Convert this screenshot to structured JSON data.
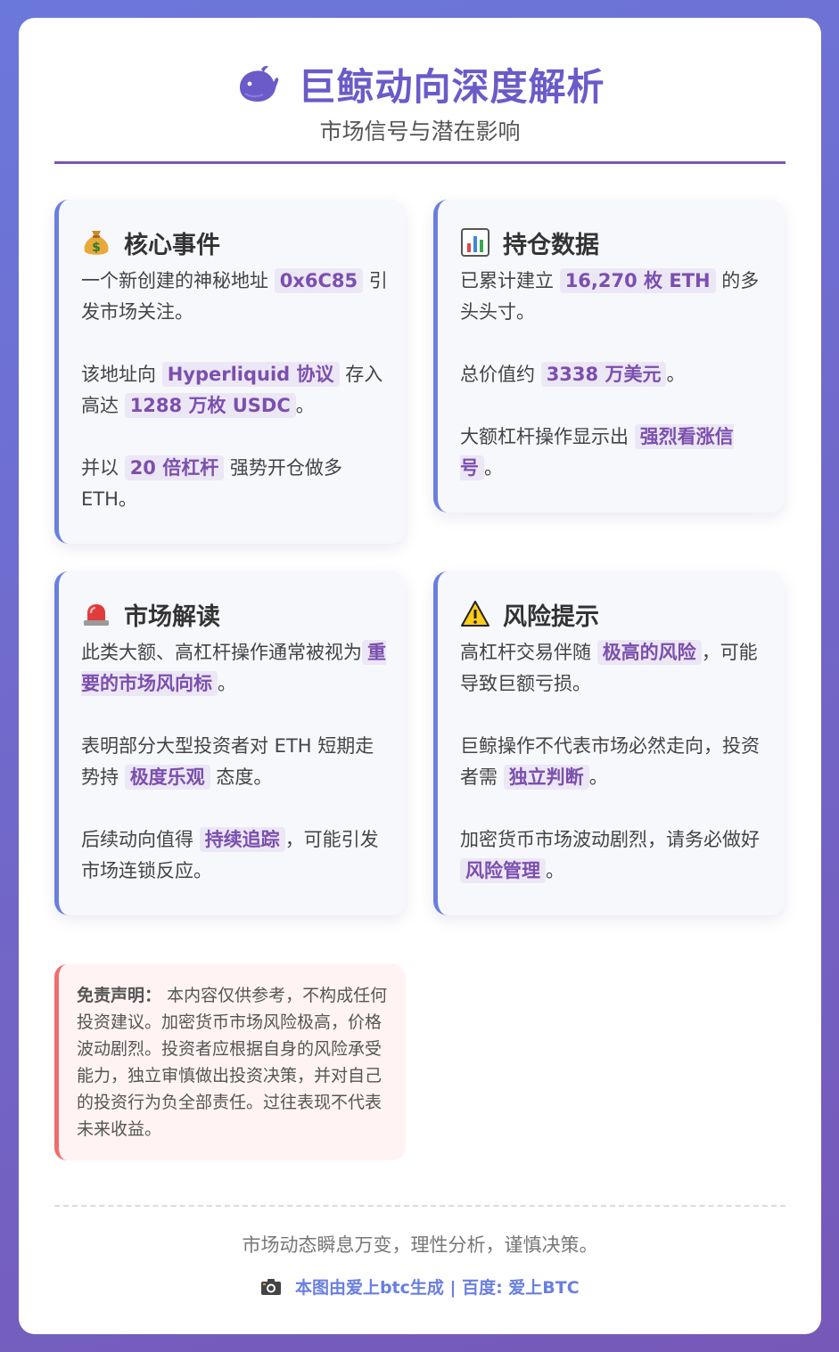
{
  "header": {
    "title": "巨鲸动向深度解析",
    "subtitle": "市场信号与潜在影响",
    "icon": "whale-icon"
  },
  "cards": {
    "core_event": {
      "icon": "money-bag-icon",
      "title": "核心事件",
      "p1_a": "一个新创建的神秘地址",
      "p1_hl": "0x6C85",
      "p1_b": "引发市场关注。",
      "p2_a": "该地址向",
      "p2_hl1": "Hyperliquid 协议",
      "p2_b": "存入高达",
      "p2_hl2": "1288 万枚 USDC",
      "p2_c": "。",
      "p3_a": "并以",
      "p3_hl": "20 倍杠杆",
      "p3_b": "强势开仓做多 ETH。"
    },
    "position": {
      "icon": "bar-chart-icon",
      "title": "持仓数据",
      "p1_a": "已累计建立",
      "p1_hl": "16,270 枚 ETH",
      "p1_b": "的多头头寸。",
      "p2_a": "总价值约",
      "p2_hl": "3338 万美元",
      "p2_b": "。",
      "p3_a": "大额杠杆操作显示出",
      "p3_hl": "强烈看涨信号",
      "p3_b": "。"
    },
    "market": {
      "icon": "siren-icon",
      "title": "市场解读",
      "p1_a": "此类大额、高杠杆操作通常被视为",
      "p1_hl": "重要的市场风向标",
      "p1_b": "。",
      "p2_a": "表明部分大型投资者对 ETH 短期走势持",
      "p2_hl": "极度乐观",
      "p2_b": "态度。",
      "p3_a": "后续动向值得",
      "p3_hl": "持续追踪",
      "p3_b": "，可能引发市场连锁反应。"
    },
    "risk": {
      "icon": "warning-icon",
      "title": "风险提示",
      "p1_a": "高杠杆交易伴随",
      "p1_hl": "极高的风险",
      "p1_b": "，可能导致巨额亏损。",
      "p2_a": "巨鲸操作不代表市场必然走向，投资者需",
      "p2_hl": "独立判断",
      "p2_b": "。",
      "p3_a": "加密货币市场波动剧烈，请务必做好",
      "p3_hl": "风险管理",
      "p3_b": "。"
    }
  },
  "disclaimer": {
    "label": "免责声明：",
    "text": "本内容仅供参考，不构成任何投资建议。加密货币市场风险极高，价格波动剧烈。投资者应根据自身的风险承受能力，独立审慎做出投资决策，并对自己的投资行为负全部责任。过往表现不代表未来收益。"
  },
  "footer": {
    "tagline": "市场动态瞬息万变，理性分析，谨慎决策。",
    "credit": "本图由爱上btc生成 | 百度: 爱上BTC",
    "icon": "camera-icon"
  },
  "colors": {
    "accent": "#6a5bc9",
    "highlight_text": "#7b4fae",
    "highlight_bg": "#ece7f5",
    "card_border": "#6a7fe0",
    "disclaimer_border": "#f06d6d"
  }
}
